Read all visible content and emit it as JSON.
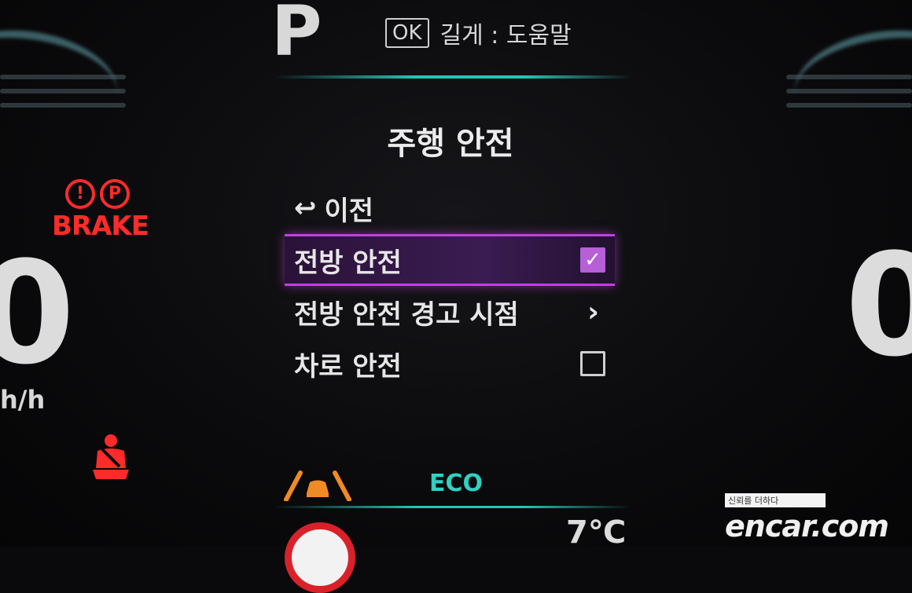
{
  "cluster": {
    "gear": "P",
    "help": {
      "ok_label": "OK",
      "text": "길게 : 도움말"
    },
    "speed_left": "0",
    "speed_unit": "h/h",
    "speed_right": "0",
    "brake_label": "BRAKE",
    "brake_icons": [
      "!",
      "P"
    ],
    "eco_label": "ECO",
    "temperature": "7℃"
  },
  "menu": {
    "title": "주행 안전",
    "back": {
      "icon": "↩",
      "label": "이전"
    },
    "items": [
      {
        "label": "전방 안전",
        "control": "checkbox",
        "checked": true,
        "selected": true
      },
      {
        "label": "전방 안전 경고 시점",
        "control": "chevron",
        "icon": "›"
      },
      {
        "label": "차로 안전",
        "control": "checkbox",
        "checked": false
      }
    ],
    "check_mark": "✓"
  },
  "watermark": {
    "tag": "신뢰를 더하다",
    "brand": "encar.com"
  },
  "colors": {
    "accent_teal": "#2bc3b6",
    "selection_purple": "#c23fe0",
    "warning_red": "#ff2b2b",
    "lane_orange": "#f08a24"
  },
  "icons": {
    "back": "back-arrow-icon",
    "brake": "brake-warning-icon",
    "seatbelt": "seatbelt-warning-icon",
    "lane": "lane-keeping-icon",
    "speed_sign": "speed-limit-sign-icon"
  }
}
